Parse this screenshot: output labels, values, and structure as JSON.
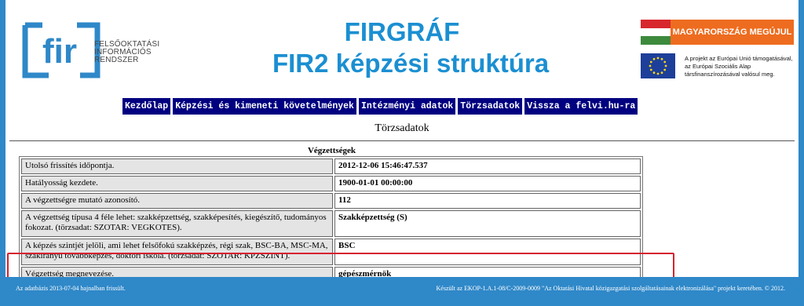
{
  "header": {
    "title": "FIRGRÁF",
    "subtitle": "FIR2 képzési struktúra",
    "logo": {
      "mark": "fir",
      "text_lines": [
        "FELSŐOKTATÁSI",
        "INFORMÁCIÓS",
        "RENDSZER"
      ]
    },
    "hu_badge": "MAGYARORSZÁG MEGÚJUL",
    "eu_text_lines": [
      "A projekt az Európai Unió támogatásával,",
      "az Európai Szociális Alap",
      "társfinanszírozásával valósul meg."
    ],
    "colors": {
      "brand": "#1b8fd2",
      "frame": "#2f88c8",
      "badge": "#ee6c1f",
      "eu": "#1d3f9a"
    }
  },
  "nav": {
    "items": [
      "Kezdőlap",
      "Képzési és kimeneti követelmények",
      "Intézményi adatok",
      "Törzsadatok",
      "Vissza a felvi.hu-ra"
    ],
    "color": "#000080"
  },
  "page": {
    "section_title": "Törzsadatok"
  },
  "table": {
    "caption": "Végzettségek",
    "rows": [
      {
        "key": "Utolsó frissítés időpontja.",
        "value": "2012-12-06 15:46:47.537"
      },
      {
        "key": "Hatályosság kezdete.",
        "value": "1900-01-01 00:00:00"
      },
      {
        "key": "A végzettségre mutató azonosító.",
        "value": "112"
      },
      {
        "key": "A végzettség típusa 4 féle lehet: szakképzettség, szakképesítés, kiegészítő, tudományos fokozat. (törzsadat: SZOTAR: VEGKOTES).",
        "value": "Szakképzettség (S)"
      },
      {
        "key": "A képzés szintjét jelöli, ami lehet felsőfokú szakképzés, régi szak, BSC-BA, MSC-MA, szakirányú továbbképzés, doktori iskola. (törzsadat: SZOTAR: KPZSZINT).",
        "value": "BSC"
      },
      {
        "key": "Végzettség megnevezése.",
        "value": "gépészmérnök"
      }
    ],
    "highlight_color": "#d62230"
  },
  "footer": {
    "left": "Az adatbázis 2013-07-04 hajnalban frissült.",
    "right": "Készült az EKOP-1.A.1-08/C-2009-0009 \"Az Oktatási Hivatal közigazgatási szolgáltatásainak elektronizálása\" projekt keretében. © 2012."
  }
}
